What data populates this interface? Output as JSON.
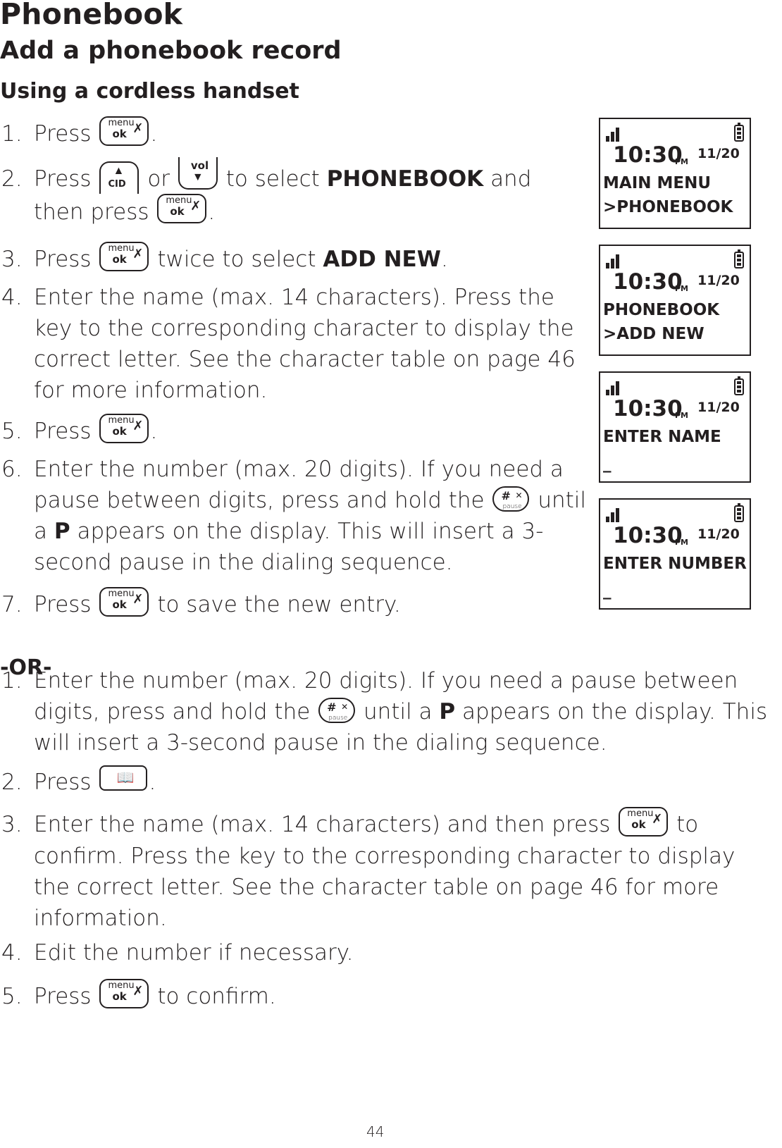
{
  "document": {
    "title": "Phonebook",
    "section_title": "Add a phonebook record",
    "subsection_title": "Using a cordless handset",
    "page_number": "44"
  },
  "keys": {
    "menu_ok": {
      "top": "menu",
      "bottom": "ok",
      "icon": "mute-mic-icon"
    },
    "cid_up": {
      "label": "CID",
      "icon": "plus-up-arrow-icon"
    },
    "vol_down": {
      "label": "vol",
      "icon": "minus-down-arrow-icon"
    },
    "hash_pause": {
      "symbol": "#",
      "label": "pause",
      "icon": "ringer-off-icon"
    },
    "phonebook": {
      "icon": "book-icon"
    }
  },
  "steps_a": [
    {
      "num": "1.",
      "pre": "Press",
      "post": "."
    },
    {
      "num": "2.",
      "pre": "Press",
      "mid": "or",
      "post1": "to select",
      "bold": "PHONEBOOK",
      "post2": "and then press",
      "end": "."
    },
    {
      "num": "3.",
      "pre": "Press",
      "post": "twice to select",
      "bold": "ADD NEW",
      "end": "."
    },
    {
      "num": "4.",
      "text": "Enter the name (max. 14 characters). Press the key to the corresponding character to display the correct letter. See the character table on page 46 for more information."
    },
    {
      "num": "5.",
      "pre": "Press",
      "post": "."
    },
    {
      "num": "6.",
      "pre": "Enter the number (max. 20 digits). If you need a pause between digits, press and hold the",
      "post": "until a",
      "bold": "P",
      "end": "appears on the display. This will insert a 3-second pause in the dialing sequence."
    },
    {
      "num": "7.",
      "pre": "Press",
      "post": "to save the new entry."
    }
  ],
  "or_label": "-OR-",
  "steps_b": [
    {
      "num": "1.",
      "pre": "Enter the number (max. 20 digits). If you need a pause between digits, press and hold the",
      "post": "until a",
      "bold": "P",
      "end": "appears on the display. This will insert a 3-second pause in the dialing sequence."
    },
    {
      "num": "2.",
      "pre": "Press",
      "post": "."
    },
    {
      "num": "3.",
      "pre": "Enter the name (max. 14 characters) and then press",
      "post": "to confirm. Press the key to the corresponding character to display the correct letter. See the character table on page 46 for more information."
    },
    {
      "num": "4.",
      "text": "Edit the number if necessary."
    },
    {
      "num": "5.",
      "pre": "Press",
      "post": "to confirm."
    }
  ],
  "screens": [
    {
      "time": "10:30",
      "ampm": "PM",
      "date": "11/20",
      "line1": "MAIN MENU",
      "line2": ">PHONEBOOK"
    },
    {
      "time": "10:30",
      "ampm": "PM",
      "date": "11/20",
      "line1": "PHONEBOOK",
      "line2": ">ADD NEW"
    },
    {
      "time": "10:30",
      "ampm": "PM",
      "date": "11/20",
      "line1": "ENTER NAME",
      "line2": "_"
    },
    {
      "time": "10:30",
      "ampm": "PM",
      "date": "11/20",
      "line1": "ENTER NUMBER",
      "line2": "_"
    }
  ]
}
